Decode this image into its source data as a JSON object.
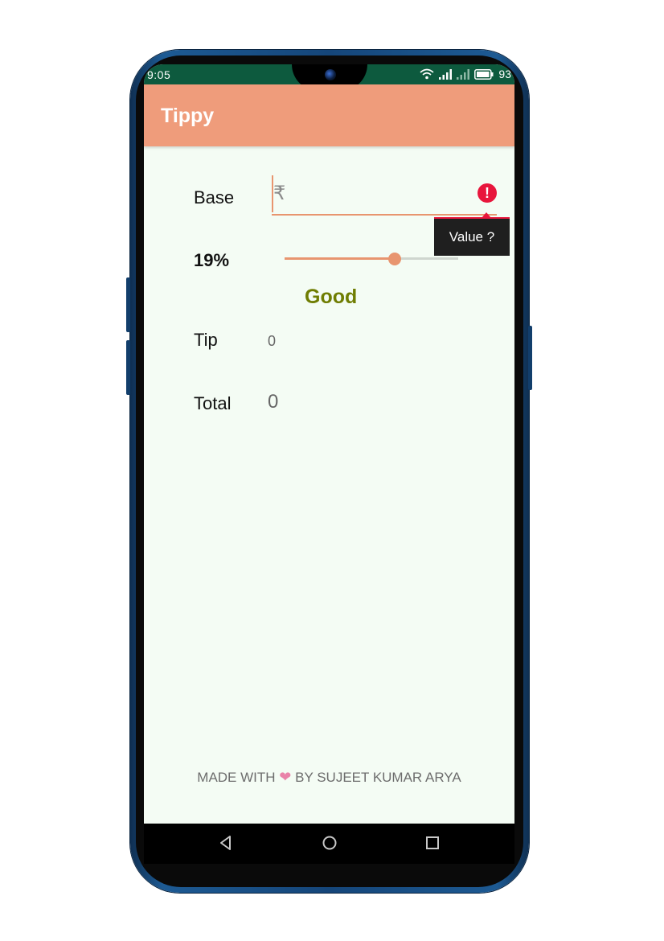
{
  "status_bar": {
    "time": "9:05",
    "battery": "93",
    "icons": [
      "wifi-icon",
      "signal-icon",
      "signal-icon",
      "battery-icon"
    ]
  },
  "app_bar": {
    "title": "Tippy"
  },
  "form": {
    "base_label": "Base",
    "base_prefix": "₹",
    "base_value": "",
    "error_tooltip": "Value ?",
    "percent_label": "19%",
    "percent_value": 19,
    "slider_max": 30,
    "rating_label": "Good",
    "tip_label": "Tip",
    "tip_value": "0",
    "total_label": "Total",
    "total_value": "0"
  },
  "footer": {
    "prefix": "MADE WITH",
    "suffix": "BY SUJEET KUMAR ARYA"
  },
  "colors": {
    "accent": "#ef9c7b",
    "status_bar": "#0d5a3e",
    "error": "#e8163c",
    "rating": "#6f7d02",
    "background": "#f4fcf4",
    "heart": "#e983a9"
  }
}
